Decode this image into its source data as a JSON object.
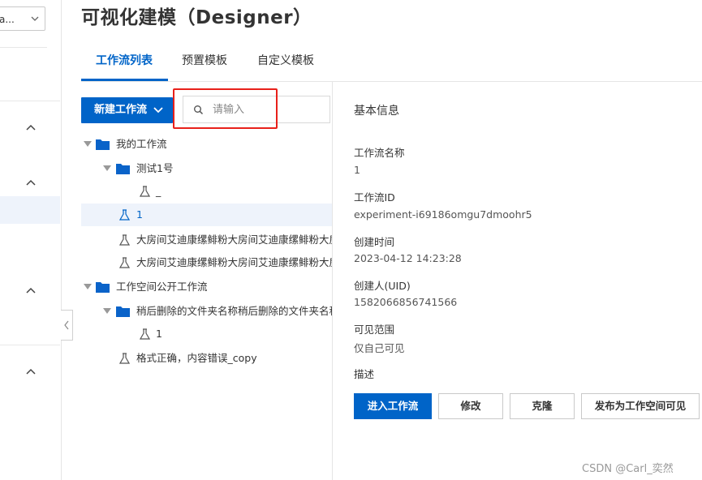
{
  "workspace_select": {
    "value": "a..."
  },
  "page_title": "可视化建模（Designer）",
  "tabs": [
    {
      "label": "工作流列表",
      "active": true
    },
    {
      "label": "预置模板",
      "active": false
    },
    {
      "label": "自定义模板",
      "active": false
    }
  ],
  "toolbar": {
    "new_workflow_label": "新建工作流",
    "search_placeholder": "请输入"
  },
  "tree": {
    "my_workflows": "我的工作流",
    "test_folder": "测试1号",
    "test_child": "_",
    "item_selected": "1",
    "long_item_1": "大房间艾迪康缧鲱粉大房间艾迪康缧鲱粉大房",
    "long_item_2": "大房间艾迪康缧鲱粉大房间艾迪康缧鲱粉大房",
    "public_workflows": "工作空间公开工作流",
    "deleted_folder": "稍后删除的文件夹名称稍后删除的文件夹名称",
    "deleted_child": "1",
    "format_item": "格式正确，内容错误_copy"
  },
  "info": {
    "heading": "基本信息",
    "fields": [
      {
        "label": "工作流名称",
        "value": "1"
      },
      {
        "label": "工作流ID",
        "value": "experiment-i69186omgu7dmoohr5"
      },
      {
        "label": "创建时间",
        "value": "2023-04-12 14:23:28"
      },
      {
        "label": "创建人(UID)",
        "value": "1582066856741566"
      },
      {
        "label": "可见范围",
        "value": "仅自己可见"
      },
      {
        "label": "描述",
        "value": ""
      }
    ]
  },
  "actions": {
    "enter": "进入工作流",
    "edit": "修改",
    "clone": "克隆",
    "publish": "发布为工作空间可见"
  },
  "watermark": "CSDN @Carl_奕然",
  "colors": {
    "accent": "#0064c8",
    "highlight": "#e8201a",
    "selected_row": "#eef3fb"
  }
}
